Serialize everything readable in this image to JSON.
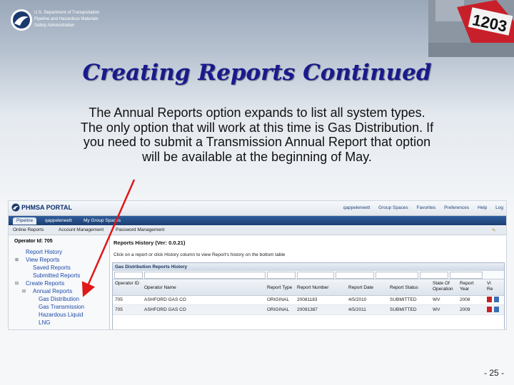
{
  "agency": {
    "line1": "U.S. Department of Transportation",
    "line2": "Pipeline and Hazardous Materials",
    "line3": "Safety Administration"
  },
  "hazmat_placard": {
    "number": "1203"
  },
  "slide": {
    "title": "Creating Reports Continued",
    "body_lines": [
      "The Annual Reports option expands to list all system types.",
      "The only option that will work at this time is Gas Distribution.  If",
      "you need to submit a Transmission Annual Report that option",
      "will be available at the beginning of May."
    ],
    "page_number": "- 25 -"
  },
  "portal": {
    "name": "PHMSA PORTAL",
    "links": [
      "qappeleneett",
      "Group Spaces",
      "Favorites",
      "Preferences",
      "Help",
      "Log"
    ],
    "tabs": [
      "Pipeline",
      "qappeleneett",
      "My Group Spaces"
    ],
    "sub_menu": [
      "Online Reports",
      "Account Management",
      "Password Management"
    ],
    "left_nav": {
      "operator": "Operator Id: 705",
      "items": [
        "Report History",
        "View Reports",
        "Saved Reports",
        "Submitted Reports",
        "Create Reports",
        "Annual Reports",
        "Gas Distribution",
        "Gas Transmission",
        "Hazardous Liquid",
        "LNG"
      ]
    },
    "main": {
      "title": "Reports History (Ver: 0.0.21)",
      "hint": "Click on a report or click History column to view Report's history on the bottom table",
      "grid_title": "Gas Distribution Reports History",
      "columns": [
        "Operator ID",
        "Operator Name",
        "Report Type",
        "Report Number",
        "Report Date",
        "Report Status",
        "State Of Operation",
        "Report Year",
        "Vi Re"
      ],
      "rows": [
        [
          "705",
          "ASHFORD GAS CO",
          "ORIGINAL",
          "20081183",
          "4/5/2010",
          "SUBMITTED",
          "WV",
          "2008"
        ],
        [
          "705",
          "ASHFORD GAS CO",
          "ORIGINAL",
          "20091387",
          "4/5/2011",
          "SUBMITTED",
          "WV",
          "2009"
        ]
      ]
    }
  }
}
